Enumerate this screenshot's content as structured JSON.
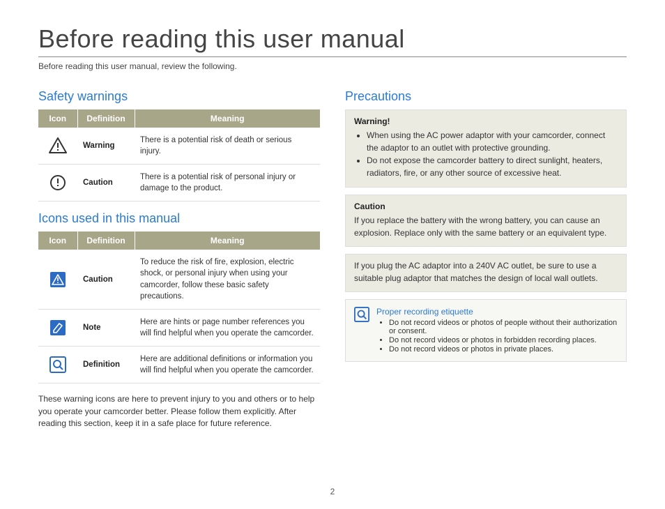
{
  "title": "Before reading this user manual",
  "intro": "Before reading this user manual, review the following.",
  "safety": {
    "heading": "Safety warnings",
    "headers": {
      "icon": "Icon",
      "definition": "Definition",
      "meaning": "Meaning"
    },
    "rows": [
      {
        "icon": "warning-triangle",
        "definition": "Warning",
        "meaning": "There is a potential risk of death or serious injury."
      },
      {
        "icon": "caution-circle",
        "definition": "Caution",
        "meaning": "There is a potential risk of personal injury or damage to the product."
      }
    ]
  },
  "icons_section": {
    "heading": "Icons used in this manual",
    "headers": {
      "icon": "Icon",
      "definition": "Definition",
      "meaning": "Meaning"
    },
    "rows": [
      {
        "icon": "caution-blue-triangle",
        "definition": "Caution",
        "meaning": "To reduce the risk of fire, explosion, electric shock, or personal injury when using your camcorder, follow these basic safety precautions."
      },
      {
        "icon": "note-blue",
        "definition": "Note",
        "meaning": "Here are hints or page number references you will find helpful when you operate the camcorder."
      },
      {
        "icon": "definition-blue-magnifier",
        "definition": "Definition",
        "meaning": "Here are additional definitions or information you will find helpful when you operate the camcorder."
      }
    ]
  },
  "icons_footer": "These warning icons are here to prevent injury to you and others or to help you operate your camcorder better. Please follow them explicitly. After reading this section, keep it in a safe place for future reference.",
  "precautions": {
    "heading": "Precautions",
    "warning_box": {
      "title": "Warning!",
      "items": [
        "When using the AC power adaptor with your camcorder, connect the adaptor to an outlet with protective grounding.",
        "Do not expose the camcorder battery to direct sunlight, heaters, radiators, fire, or any other source of excessive heat."
      ]
    },
    "caution_box": {
      "title": "Caution",
      "text": "If you replace the battery with the wrong battery, you can cause an explosion. Replace only with the same battery or an equivalent type."
    },
    "note_box": {
      "text": "If you plug the AC adaptor into a 240V AC outlet, be sure to use a suitable plug adaptor that matches the design of local wall outlets."
    },
    "etiquette": {
      "title": "Proper recording etiquette",
      "items": [
        "Do not record videos or photos of people without their authorization or consent.",
        "Do not record videos or photos in forbidden recording places.",
        "Do not record videos or photos in private places."
      ]
    }
  },
  "page_number": "2"
}
